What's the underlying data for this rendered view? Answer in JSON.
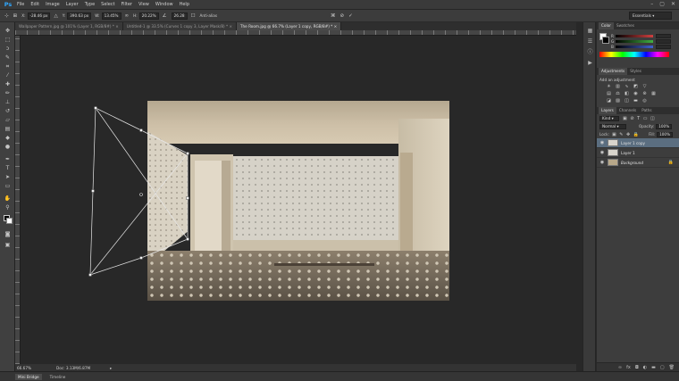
{
  "app": {
    "logo_text": "Ps"
  },
  "menu": [
    "File",
    "Edit",
    "Image",
    "Layer",
    "Type",
    "Select",
    "Filter",
    "View",
    "Window",
    "Help"
  ],
  "window_controls": [
    "–",
    "▢",
    "✕"
  ],
  "options_bar": {
    "x_value": "-28.46 px",
    "y_value": "390.63 px",
    "w_label": "W:",
    "w_value": "13.45%",
    "h_label": "H:",
    "h_value": "20.22%",
    "angle_value": "26.28",
    "antialias_label": "Anti-alias",
    "workspace": "Essentials"
  },
  "tabs": [
    {
      "label": "Wallpaper Pattern.jpg @ 101% (Layer 1, RGB/8#) *",
      "active": false
    },
    {
      "label": "Untitled-1 @ 33.5% (Curves 1 copy 3, Layer Mask/8) *",
      "active": false
    },
    {
      "label": "The Room.jpg @ 66.7% (Layer 1 copy, RGB/8#) *",
      "active": true
    }
  ],
  "status": {
    "zoom": "66.67%",
    "doc": "Doc: 3.13M/6.87M"
  },
  "bottom_tabs": [
    {
      "label": "Mini Bridge",
      "active": true
    },
    {
      "label": "Timeline",
      "active": false
    }
  ],
  "panels": {
    "color_tabs": [
      "Color",
      "Swatches"
    ],
    "color_channels": [
      {
        "label": "R",
        "color": "#d04040"
      },
      {
        "label": "G",
        "color": "#40b040"
      },
      {
        "label": "B",
        "color": "#4060d0"
      }
    ],
    "adjust_tabs": [
      "Adjustments",
      "Styles"
    ],
    "adjust_title": "Add an adjustment",
    "layers_tabs": [
      "Layers",
      "Channels",
      "Paths"
    ],
    "kind_label": "Kind",
    "blend_mode": "Normal",
    "opacity_label": "Opacity:",
    "opacity_value": "100%",
    "lock_label": "Lock:",
    "fill_label": "Fill:",
    "fill_value": "100%",
    "layers": [
      {
        "name": "Layer 1 copy",
        "selected": true,
        "italic": false,
        "thumb": "#d8d4cc"
      },
      {
        "name": "Layer 1",
        "selected": false,
        "italic": false,
        "thumb": "#d8d4cc"
      },
      {
        "name": "Background",
        "selected": false,
        "italic": true,
        "thumb": "#b8a88a"
      }
    ]
  },
  "colors": {
    "accent": "#30a8ff",
    "selected_layer": "#5b6e80",
    "background": "#282828"
  }
}
